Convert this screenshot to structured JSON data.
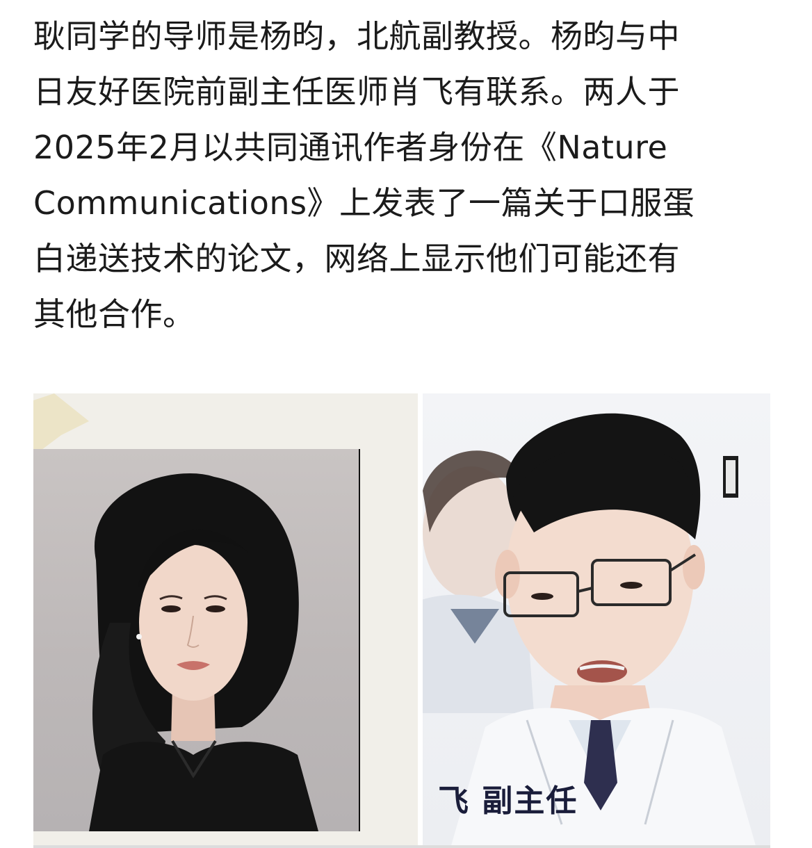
{
  "article": {
    "lines": [
      "耿同学的导师是杨昀，北航副教授。杨昀与中",
      "日友好医院前副主任医师肖飞有联系。两人于",
      "2025年2月以共同通讯作者身份在《Nature",
      "Communications》上发表了一篇关于口服蛋",
      "白递送技术的论文，网络上显示他们可能还有",
      "其他合作。"
    ]
  },
  "photos": {
    "right_caption": "飞 副主任"
  }
}
